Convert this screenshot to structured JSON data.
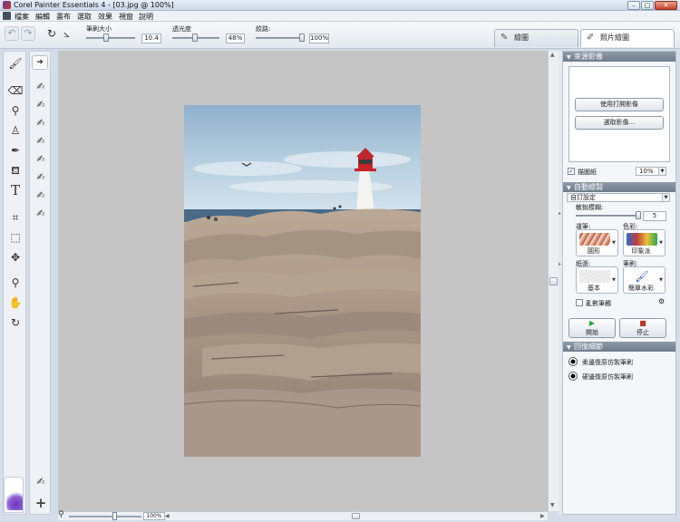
{
  "window": {
    "title": "Corel Painter Essentials 4 - [03.jpg @ 100%]",
    "controls": {
      "minimize": "–",
      "maximize": "□",
      "close": "✕"
    }
  },
  "menu": {
    "items": [
      "檔案",
      "編輯",
      "畫布",
      "選取",
      "效果",
      "視窗",
      "說明"
    ]
  },
  "property_bar": {
    "brush_size_label": "筆刷大小",
    "brush_size_value": "10.4",
    "opacity_label": "透光度",
    "opacity_value": "48%",
    "grain_label": "紋路:",
    "grain_value": "100%"
  },
  "mode_tabs": {
    "inactive_label": "繪圖",
    "active_label": "照片繪圖"
  },
  "canvas": {
    "background": "#c5c5c5",
    "zoom_value": "100%",
    "horizontal_scroll": 0.5,
    "vertical_scroll": 0.5
  },
  "right_panel": {
    "source": {
      "header": "來源影像",
      "use_open_image": "使用打開影像",
      "select_image": "選取影像...",
      "tracing_paper_label": "描圖紙",
      "tracing_paper_checked": true,
      "tracing_value": "10%"
    },
    "auto_paint": {
      "header": "自動繪製",
      "preset": "自訂設定",
      "sensitivity_label": "敏銳模糊:",
      "sensitivity_value": "5",
      "stroke_label": "運筆:",
      "stroke_name": "圓形",
      "color_label": "色彩:",
      "color_name": "印象派",
      "paper_label": "紙張:",
      "paper_name": "基本",
      "brush_label": "筆刷:",
      "brush_name": "簡單水彩",
      "randomize_label": "亂數筆觸",
      "randomize_checked": false,
      "start_label": "開始",
      "stop_label": "停止"
    },
    "restore_detail": {
      "header": "回復細節",
      "soft_edge_label": "柔邊復原仿製筆刷",
      "hard_edge_label": "硬邊復原仿製筆刷"
    }
  },
  "colors": {
    "accent": "#6f7c8c",
    "start_icon": "#2ea043",
    "stop_icon": "#b03a2e",
    "paint_swatch": "#7b4bc4"
  },
  "icons": {
    "toolbox": [
      "brush-icon",
      "eraser-icon",
      "dropper-icon",
      "clone-stamp-icon",
      "paint-bucket-icon",
      "text-icon",
      "crop-icon",
      "selection-icon",
      "transform-icon",
      "magnifier-icon",
      "hand-icon",
      "rotate-icon"
    ],
    "brush_library": [
      "expand-icon",
      "brush-icon",
      "clone-brush-icon"
    ]
  }
}
